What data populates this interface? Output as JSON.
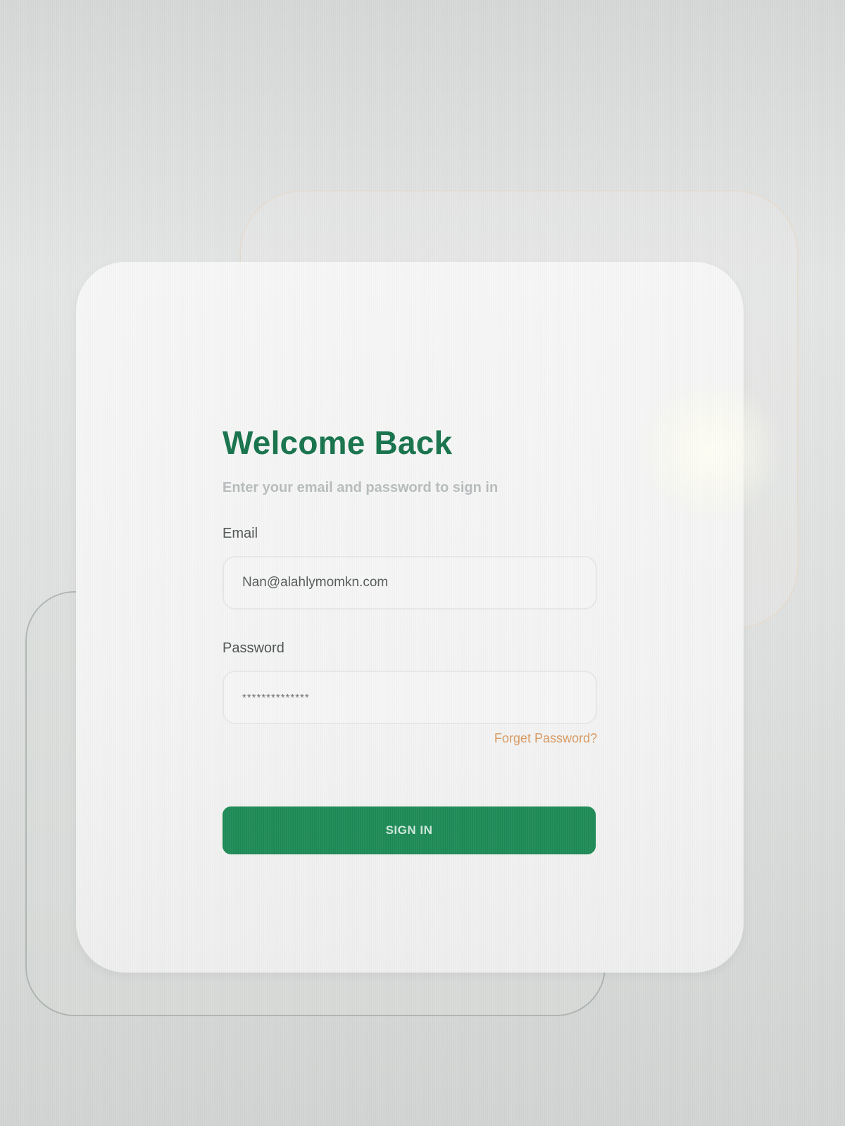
{
  "login": {
    "title": "Welcome Back",
    "subtitle": "Enter your email and password to sign in",
    "email": {
      "label": "Email",
      "value": "Nan@alahlymomkn.com"
    },
    "password": {
      "label": "Password",
      "masked_value": "**************"
    },
    "forgot_password_label": "Forget Password?",
    "signin_label": "SIGN IN"
  },
  "colors": {
    "accent": "#1c8a55",
    "title": "#14724a",
    "link": "#d99a62"
  }
}
